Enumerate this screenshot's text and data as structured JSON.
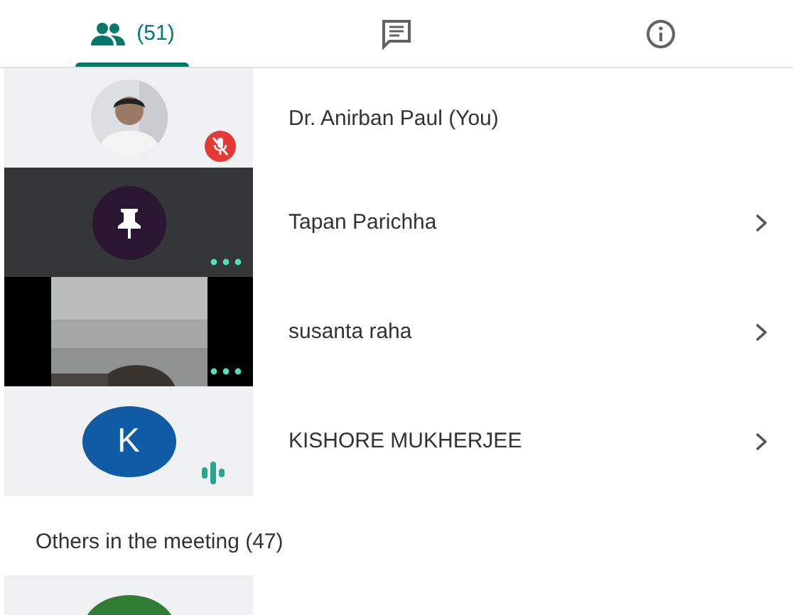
{
  "tabs": [
    {
      "kind": "people",
      "label": "(51)",
      "selected": true
    },
    {
      "kind": "chat",
      "selected": false
    },
    {
      "kind": "info",
      "selected": false
    }
  ],
  "participants": [
    {
      "name": "Dr. Anirban Paul (You)",
      "status": {
        "kind": "muted"
      },
      "chevron": false
    },
    {
      "kind": "pin",
      "name": "Tapan Parichha",
      "status": {
        "kind": "more"
      },
      "chevron": true
    },
    {
      "kind": "video",
      "name": "susanta raha",
      "status": {
        "kind": "more"
      },
      "chevron": true
    },
    {
      "kind": "initial",
      "initial": "K",
      "color": "#0f5ba6",
      "name": "KISHORE MUKHERJEE",
      "status": {
        "kind": "speaking"
      },
      "chevron": true
    }
  ],
  "others": {
    "heading": "Others in the meeting (47)",
    "participants": [
      {
        "kind": "initial",
        "color": "#2e7d32"
      }
    ]
  }
}
